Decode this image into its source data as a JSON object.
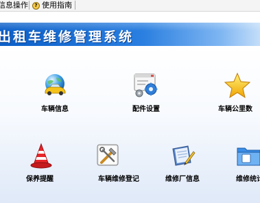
{
  "menubar": {
    "info_ops_label": "信息操作",
    "user_guide_label": "使用指南",
    "help_icon": "question-mark-icon"
  },
  "banner": {
    "title": "出租车维修管理系统",
    "gradient_start": "#0b5fc8",
    "gradient_end": "#c4def9"
  },
  "tiles": [
    {
      "label": "车辆信息",
      "icon": "globe-car-icon"
    },
    {
      "label": "配件设置",
      "icon": "settings-gears-icon"
    },
    {
      "label": "车辆公里数",
      "icon": "star-icon"
    },
    {
      "label": "保养提醒",
      "icon": "traffic-cone-icon"
    },
    {
      "label": "车辆维修登记",
      "icon": "tools-icon"
    },
    {
      "label": "维修厂信息",
      "icon": "notebook-pen-icon"
    },
    {
      "label": "维修统计",
      "icon": "folder-icon"
    }
  ]
}
